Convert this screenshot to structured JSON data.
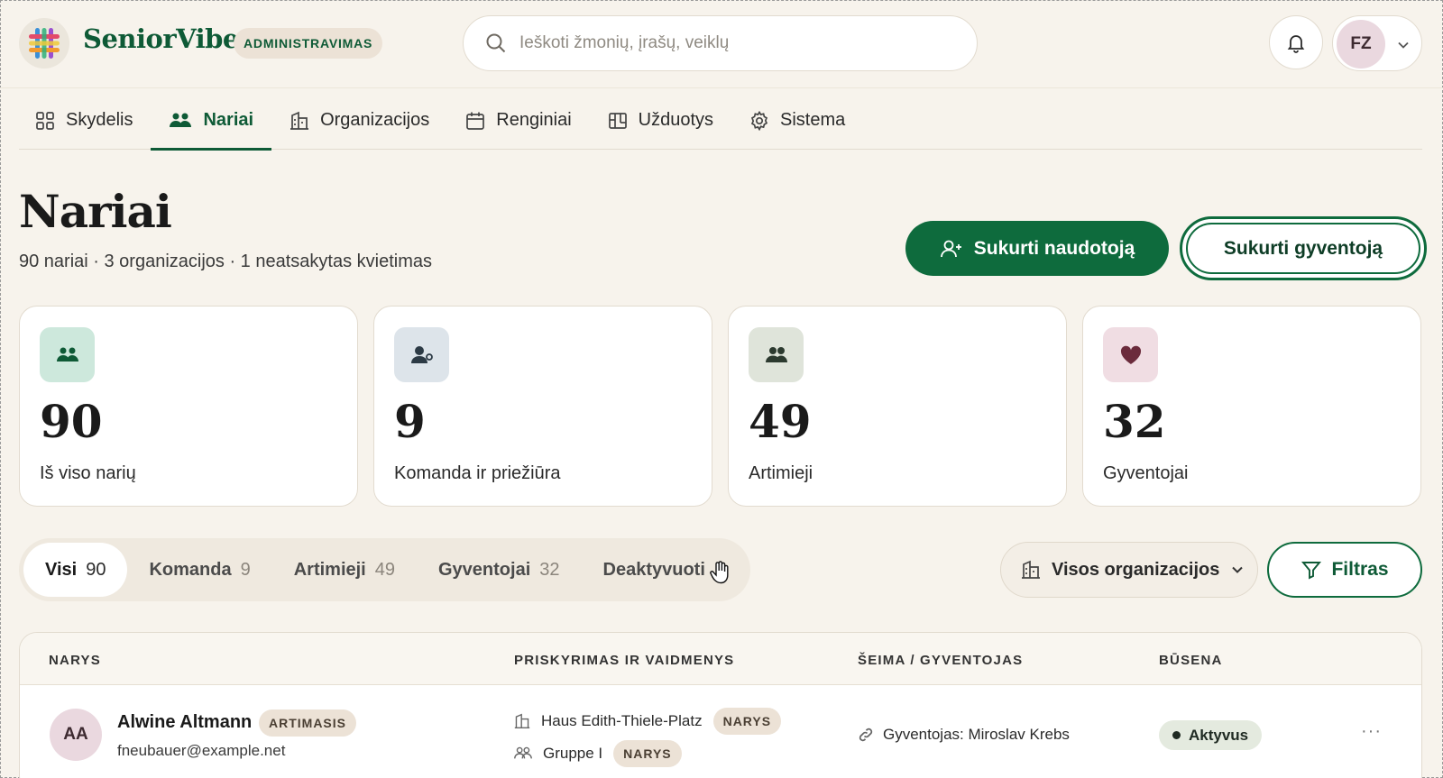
{
  "header": {
    "brand": "SeniorVibe",
    "admin_badge": "ADMINISTRAVIMAS",
    "search_placeholder": "Ieškoti žmonių, įrašų, veiklų",
    "user_initials": "FZ"
  },
  "nav": {
    "items": [
      {
        "label": "Skydelis",
        "icon": "grid-icon"
      },
      {
        "label": "Nariai",
        "icon": "users-icon",
        "active": true
      },
      {
        "label": "Organizacijos",
        "icon": "building-icon"
      },
      {
        "label": "Renginiai",
        "icon": "calendar-icon"
      },
      {
        "label": "Užduotys",
        "icon": "kanban-icon"
      },
      {
        "label": "Sistema",
        "icon": "gear-icon"
      }
    ]
  },
  "page": {
    "title": "Nariai",
    "subtitle": "90 nariai · 3 organizacijos · 1 neatsakytas kvietimas",
    "create_user_label": "Sukurti naudotoją",
    "create_resident_label": "Sukurti gyventoją"
  },
  "stats": [
    {
      "value": "90",
      "label": "Iš viso narių",
      "icon": "users-icon",
      "color": "#cde8dc"
    },
    {
      "value": "9",
      "label": "Komanda ir priežiūra",
      "icon": "user-gear-icon",
      "color": "#dde4ea"
    },
    {
      "value": "49",
      "label": "Artimieji",
      "icon": "user-group-icon",
      "color": "#dfe4da"
    },
    {
      "value": "32",
      "label": "Gyventojai",
      "icon": "heart-icon",
      "color": "#f0dde3"
    }
  ],
  "filters": {
    "tabs": [
      {
        "label": "Visi",
        "count": "90",
        "active": true
      },
      {
        "label": "Komanda",
        "count": "9"
      },
      {
        "label": "Artimieji",
        "count": "49"
      },
      {
        "label": "Gyventojai",
        "count": "32"
      },
      {
        "label": "Deaktyvuoti",
        "count": ""
      }
    ],
    "org_select": "Visos organizacijos",
    "filter_label": "Filtras"
  },
  "table": {
    "headers": [
      "NARYS",
      "PRISKYRIMAS IR VAIDMENYS",
      "ŠEIMA / GYVENTOJAS",
      "BŪSENA"
    ],
    "rows": [
      {
        "initials": "AA",
        "name": "Alwine Altmann",
        "role": "ARTIMASIS",
        "email": "fneubauer@example.net",
        "assignments": [
          {
            "name": "Haus Edith-Thiele-Platz",
            "role": "NARYS"
          },
          {
            "name": "Gruppe I",
            "role": "NARYS"
          }
        ],
        "family": "Gyventojas: Miroslav Krebs",
        "status": "Aktyvus",
        "more": "···"
      }
    ]
  },
  "colors": {
    "accent": "#0e6b3d",
    "background": "#f7f3ec"
  }
}
